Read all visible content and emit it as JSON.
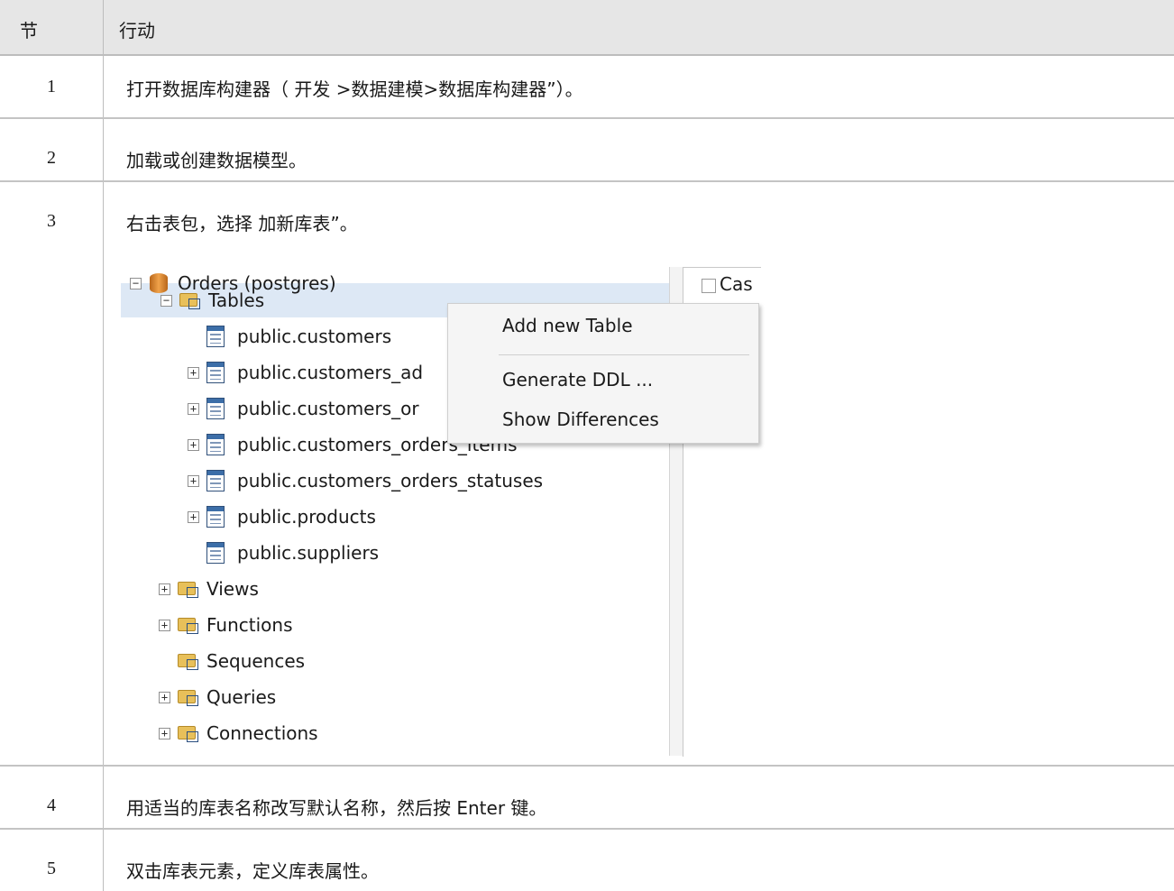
{
  "table": {
    "headers": {
      "section": "节",
      "action": "行动"
    },
    "rows": [
      {
        "section": "1",
        "action": "打开数据库构建器（ 开发 >数据建模>数据库构建器”）。"
      },
      {
        "section": "2",
        "action": "加载或创建数据模型。"
      },
      {
        "section": "3",
        "action": "右击表包，选择 加新库表”。"
      },
      {
        "section": "4",
        "action": "用适当的库表名称改写默认名称，然后按 Enter 键。"
      },
      {
        "section": "5",
        "action": "双击库表元素，定义库表属性。"
      }
    ]
  },
  "screenshot": {
    "tree": {
      "root": "Orders (postgres)",
      "tables_folder": "Tables",
      "tables": [
        "public.customers",
        "public.customers_ad",
        "public.customers_or",
        "public.customers_orders_items",
        "public.customers_orders_statuses",
        "public.products",
        "public.suppliers"
      ],
      "folders": [
        "Views",
        "Functions",
        "Sequences",
        "Queries",
        "Connections"
      ]
    },
    "context_menu": [
      "Add new Table",
      "Generate DDL ...",
      "Show Differences"
    ],
    "side_panel_checkbox_label": "Cas"
  },
  "colors": {
    "header_bg": "#e6e6e6",
    "selection": "#dde8f5"
  }
}
